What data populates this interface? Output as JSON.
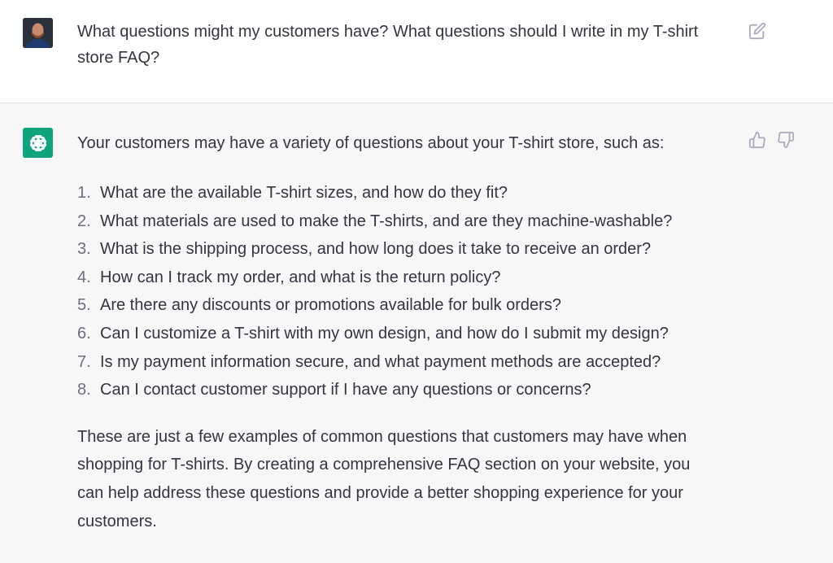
{
  "user_message": {
    "text": "What questions might my customers have? What questions should I write in my T-shirt store FAQ?"
  },
  "assistant_message": {
    "intro": "Your customers may have a variety of questions about your T-shirt store, such as:",
    "items": [
      {
        "number": "1.",
        "text": "What are the available T-shirt sizes, and how do they fit?"
      },
      {
        "number": "2.",
        "text": "What materials are used to make the T-shirts, and are they machine-washable?"
      },
      {
        "number": "3.",
        "text": "What is the shipping process, and how long does it take to receive an order?"
      },
      {
        "number": "4.",
        "text": "How can I track my order, and what is the return policy?"
      },
      {
        "number": "5.",
        "text": "Are there any discounts or promotions available for bulk orders?"
      },
      {
        "number": "6.",
        "text": "Can I customize a T-shirt with my own design, and how do I submit my design?"
      },
      {
        "number": "7.",
        "text": "Is my payment information secure, and what payment methods are accepted?"
      },
      {
        "number": "8.",
        "text": "Can I contact customer support if I have any questions or concerns?"
      }
    ],
    "outro": "These are just a few examples of common questions that customers may have when shopping for T-shirts. By creating a comprehensive FAQ section on your website, you can help address these questions and provide a better shopping experience for your customers."
  },
  "icons": {
    "edit": "edit-icon",
    "thumbs_up": "thumbs-up-icon",
    "thumbs_down": "thumbs-down-icon",
    "bot": "openai-logo-icon"
  },
  "colors": {
    "bot_avatar": "#10a37f",
    "assistant_bg": "#f7f7f8",
    "user_bg": "#ffffff",
    "text": "#343541"
  }
}
